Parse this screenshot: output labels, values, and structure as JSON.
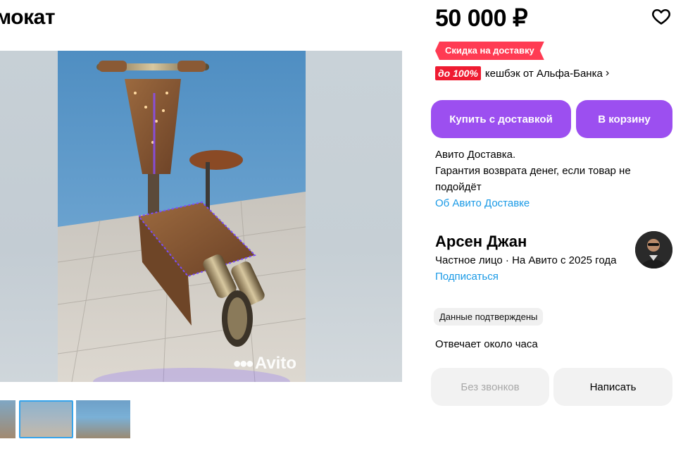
{
  "listing": {
    "title": "мокат",
    "price": "50 000 ₽",
    "promo_label": "Скидка на доставку",
    "cashback_badge": "до 100%",
    "cashback_text": "кешбэк от Альфа-Банка",
    "cashback_chevron": "›"
  },
  "gallery": {
    "watermark": "Avito",
    "thumbnail_count": 3,
    "active_thumbnail": 2
  },
  "actions": {
    "buy_label": "Купить с доставкой",
    "cart_label": "В корзину"
  },
  "delivery": {
    "line1": "Авито Доставка.",
    "line2": "Гарантия возврата денег, если товар не подойдёт",
    "link": "Об Авито Доставке"
  },
  "seller": {
    "name": "Арсен Джан",
    "info": "Частное лицо · На Авито с 2025 года",
    "subscribe": "Подписаться",
    "verified": "Данные подтверждены",
    "response_time": "Отвечает около часа"
  },
  "contact": {
    "no_calls_label": "Без звонков",
    "write_label": "Написать"
  },
  "colors": {
    "accent_purple": "#9c4ff0",
    "promo_red": "#ff3b53",
    "cashback_red": "#ef1b31",
    "link_blue": "#1a9ae6",
    "thumb_active_border": "#36a3ea"
  },
  "icons": {
    "favorite": "heart-outline-icon",
    "watermark_logo": "avito-logo-icon"
  }
}
